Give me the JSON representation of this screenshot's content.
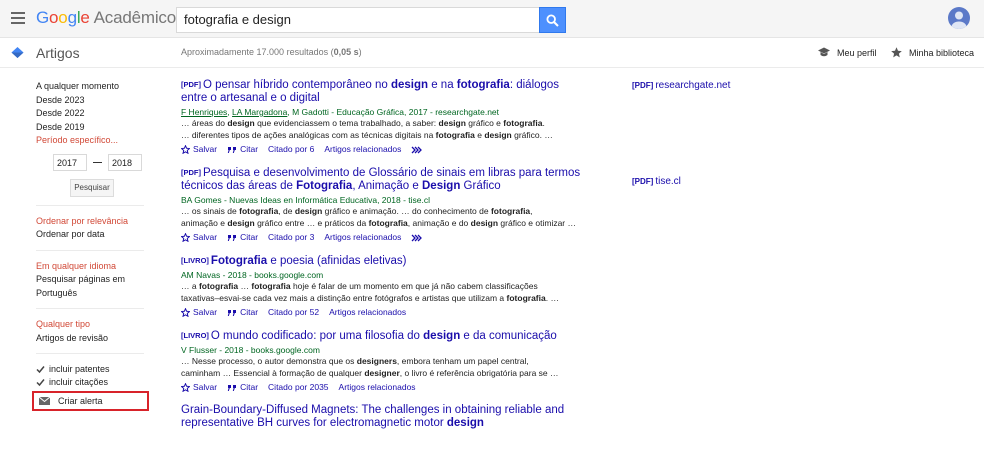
{
  "topbar": {
    "logo_letters": [
      "G",
      "o",
      "o",
      "g",
      "l",
      "e"
    ],
    "logo_suffix": "Acadêmico",
    "search_value": "fotografia e design"
  },
  "header": {
    "section": "Artigos",
    "results_prefix": "Aproximadamente 17.000 resultados (",
    "results_time": "0,05 s",
    "results_suffix": ")",
    "my_profile": "Meu perfil",
    "my_library": "Minha biblioteca"
  },
  "sidebar": {
    "time_filters": [
      "A qualquer momento",
      "Desde 2023",
      "Desde 2022",
      "Desde 2019"
    ],
    "custom_range_label": "Período específico...",
    "year_from": "2017",
    "year_to": "2018",
    "search_button": "Pesquisar",
    "sort_relevance": "Ordenar por relevância",
    "sort_date": "Ordenar por data",
    "language_any": "Em qualquer idioma",
    "language_pt": "Pesquisar páginas em Português",
    "type_any": "Qualquer tipo",
    "type_review": "Artigos de revisão",
    "include_patents": "incluir patentes",
    "include_citations": "incluir citações",
    "create_alert": "Criar alerta"
  },
  "actions": {
    "save": "Salvar",
    "cite": "Citar",
    "related": "Artigos relacionados"
  },
  "results": [
    {
      "tag": "[PDF]",
      "title_parts": [
        {
          "t": "O pensar híbrido contemporâneo no ",
          "b": false
        },
        {
          "t": "design",
          "b": true
        },
        {
          "t": " e na ",
          "b": false
        },
        {
          "t": "fotografia",
          "b": true
        },
        {
          "t": ": diálogos entre o artesanal e o digital",
          "b": false
        }
      ],
      "authors_linked": [
        "F Henriques",
        "LA Margadona"
      ],
      "source_rest": ", M Gadotti - Educação Gráfica, 2017 - researchgate.net",
      "snippet_lines": [
        [
          {
            "t": "… áreas do ",
            "b": false
          },
          {
            "t": "design",
            "b": true
          },
          {
            "t": " que evidenciassem o tema trabalhado, a saber: ",
            "b": false
          },
          {
            "t": "design",
            "b": true
          },
          {
            "t": " gráfico e ",
            "b": false
          },
          {
            "t": "fotografia",
            "b": true
          },
          {
            "t": ".",
            "b": false
          }
        ],
        [
          {
            "t": "… diferentes tipos de ações analógicas com as técnicas digitais na ",
            "b": false
          },
          {
            "t": "fotografia",
            "b": true
          },
          {
            "t": " e ",
            "b": false
          },
          {
            "t": "design",
            "b": true
          },
          {
            "t": " gráfico. …",
            "b": false
          }
        ]
      ],
      "cited": "Citado por 6",
      "versions": true,
      "side_tag": "[PDF]",
      "side_link": "researchgate.net"
    },
    {
      "tag": "[PDF]",
      "title_parts": [
        {
          "t": "Pesquisa e desenvolvimento de Glossário de sinais em libras para termos técnicos das áreas de ",
          "b": false
        },
        {
          "t": "Fotografia",
          "b": true
        },
        {
          "t": ", Animação e ",
          "b": false
        },
        {
          "t": "Design",
          "b": true
        },
        {
          "t": " Gráfico",
          "b": false
        }
      ],
      "authors_linked": [],
      "source_rest": "BA Gomes - Nuevas Ideas en Informática Educativa, 2018 - tise.cl",
      "snippet_lines": [
        [
          {
            "t": "… os sinais de ",
            "b": false
          },
          {
            "t": "fotografia",
            "b": true
          },
          {
            "t": ", de ",
            "b": false
          },
          {
            "t": "design",
            "b": true
          },
          {
            "t": " gráfico e animação. … do conhecimento de ",
            "b": false
          },
          {
            "t": "fotografia",
            "b": true
          },
          {
            "t": ",",
            "b": false
          }
        ],
        [
          {
            "t": "animação e ",
            "b": false
          },
          {
            "t": "design",
            "b": true
          },
          {
            "t": " gráfico entre … e práticos da ",
            "b": false
          },
          {
            "t": "fotografia",
            "b": true
          },
          {
            "t": ", animação e do ",
            "b": false
          },
          {
            "t": "design",
            "b": true
          },
          {
            "t": " gráfico e otimizar …",
            "b": false
          }
        ]
      ],
      "cited": "Citado por 3",
      "versions": true,
      "side_tag": "[PDF]",
      "side_link": "tise.cl"
    },
    {
      "tag": "[LIVRO]",
      "title_parts": [
        {
          "t": "Fotografia",
          "b": true
        },
        {
          "t": " e poesia (afinidas eletivas)",
          "b": false
        }
      ],
      "authors_linked": [],
      "source_rest": "AM Navas - 2018 - books.google.com",
      "snippet_lines": [
        [
          {
            "t": "… a ",
            "b": false
          },
          {
            "t": "fotografia",
            "b": true
          },
          {
            "t": " … ",
            "b": false
          },
          {
            "t": "fotografia",
            "b": true
          },
          {
            "t": " hoje é falar de um momento em que já não cabem classificações",
            "b": false
          }
        ],
        [
          {
            "t": "taxativas–esvai-se cada vez mais a distinção entre fotógrafos e artistas que utilizam a ",
            "b": false
          },
          {
            "t": "fotografia",
            "b": true
          },
          {
            "t": ". …",
            "b": false
          }
        ]
      ],
      "cited": "Citado por 52",
      "versions": false,
      "side_tag": "",
      "side_link": ""
    },
    {
      "tag": "[LIVRO]",
      "title_parts": [
        {
          "t": "O mundo codificado: por uma filosofia do ",
          "b": false
        },
        {
          "t": "design",
          "b": true
        },
        {
          "t": " e da comunicação",
          "b": false
        }
      ],
      "authors_linked": [],
      "source_rest": "V Flusser - 2018 - books.google.com",
      "snippet_lines": [
        [
          {
            "t": "… Nesse processo, o autor demonstra que os ",
            "b": false
          },
          {
            "t": "designers",
            "b": true
          },
          {
            "t": ", embora tenham um papel central,",
            "b": false
          }
        ],
        [
          {
            "t": "caminham … Essencial à formação de qualquer ",
            "b": false
          },
          {
            "t": "designer",
            "b": true
          },
          {
            "t": ", o livro é referência obrigatória para se …",
            "b": false
          }
        ]
      ],
      "cited": "Citado por 2035",
      "versions": false,
      "side_tag": "",
      "side_link": ""
    },
    {
      "tag": "",
      "title_parts": [
        {
          "t": "Grain-Boundary-Diffused Magnets: The challenges in obtaining reliable and representative BH curves for electromagnetic motor ",
          "b": false
        },
        {
          "t": "design",
          "b": true
        }
      ],
      "authors_linked": [],
      "source_rest": "",
      "snippet_lines": [],
      "cited": "",
      "versions": false,
      "side_tag": "",
      "side_link": ""
    }
  ]
}
